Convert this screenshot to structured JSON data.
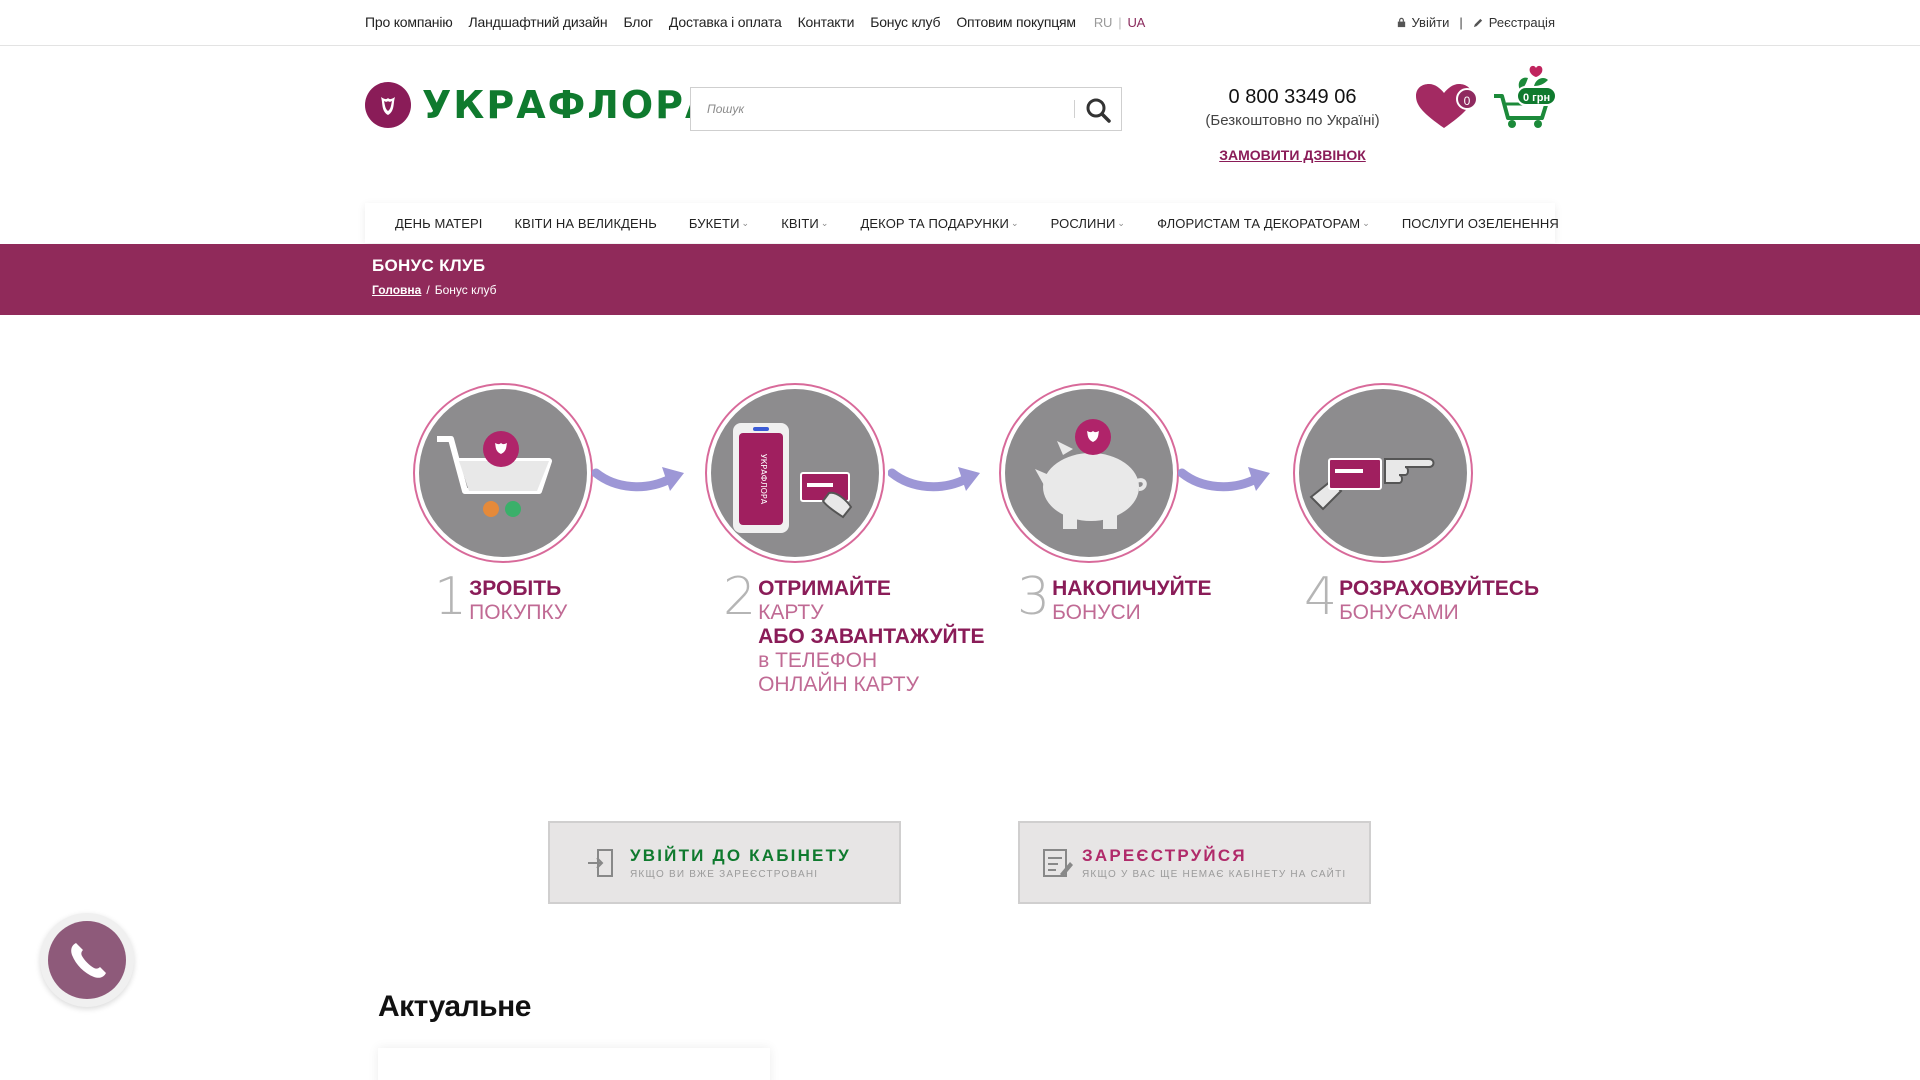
{
  "topbar": {
    "links": [
      "Про компанію",
      "Ландшафтний дизайн",
      "Блог",
      "Доставка і оплата",
      "Контакти",
      "Бонус клуб",
      "Оптовим покупцям"
    ],
    "lang_ru": "RU",
    "lang_sep": "|",
    "lang_ua": "UA",
    "login": "Увійти",
    "auth_sep": "|",
    "register": "Реєстрація"
  },
  "header": {
    "logo_text": "УКРАФЛОРА",
    "search_placeholder": "Пошук",
    "phone_number": "0 800 3349 06",
    "phone_note": "(Безкоштовно по Україні)",
    "callback": "ЗАМОВИТИ ДЗВІНОК",
    "wishlist_count": "0",
    "cart_total": "0 грн"
  },
  "menu": {
    "items": [
      {
        "label": "ДЕНЬ МАТЕРІ",
        "dropdown": false
      },
      {
        "label": "КВІТИ НА ВЕЛИКДЕНЬ",
        "dropdown": false
      },
      {
        "label": "БУКЕТИ",
        "dropdown": true
      },
      {
        "label": "КВІТИ",
        "dropdown": true
      },
      {
        "label": "ДЕКОР ТА ПОДАРУНКИ",
        "dropdown": true
      },
      {
        "label": "РОСЛИНИ",
        "dropdown": true
      },
      {
        "label": "ФЛОРИСТАМ ТА ДЕКОРАТОРАМ",
        "dropdown": true
      },
      {
        "label": "ПОСЛУГИ ОЗЕЛЕНЕННЯ",
        "dropdown": false
      }
    ]
  },
  "banner": {
    "title": "БОНУС КЛУБ",
    "crumb_home": "Головна",
    "crumb_sep": "/",
    "crumb_current": "Бонус клуб"
  },
  "steps": [
    {
      "num": "1",
      "bold": "ЗРОБІТЬ",
      "light": "ПОКУПКУ",
      "icon": "cart-icon"
    },
    {
      "num": "2",
      "bold": "ОТРИМАЙТЕ",
      "light": "КАРТУ",
      "bold2": "АБО ЗАВАНТАЖУЙТЕ",
      "light2": "в ТЕЛЕФОН",
      "light3": "ОНЛАЙН КАРТУ",
      "icon": "phone-card-icon",
      "phone_text": "УКРАФЛОРА"
    },
    {
      "num": "3",
      "bold": "НАКОПИЧУЙТЕ",
      "light": "БОНУСИ",
      "icon": "piggy-bank-icon"
    },
    {
      "num": "4",
      "bold": "РОЗРАХОВУЙТЕСЬ",
      "light": "БОНУСАМИ",
      "icon": "card-payment-icon"
    }
  ],
  "actions": {
    "login_title": "УВІЙТИ ДО КАБІНЕТУ",
    "login_sub": "ЯКЩО ВИ ВЖЕ ЗАРЕЄСТРОВАНІ",
    "register_title": "ЗАРЕЄСТРУЙСЯ",
    "register_sub": "ЯКЩО У ВАС ЩЕ НЕМАЄ КАБІНЕТУ НА САЙТІ"
  },
  "section": {
    "title": "Актуальне"
  },
  "colors": {
    "brand_purple": "#902a5a",
    "brand_green": "#0f7a2e",
    "accent_pink": "#b02a6a"
  }
}
